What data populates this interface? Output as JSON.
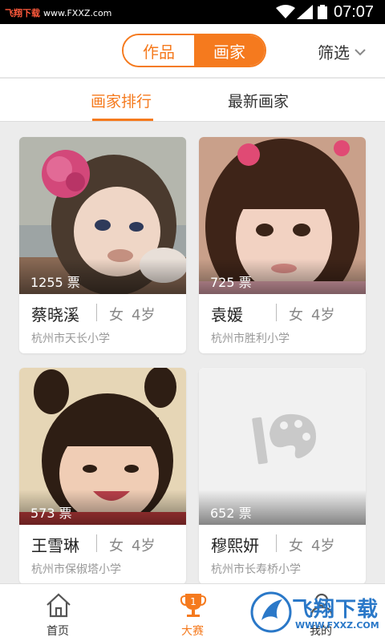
{
  "status_bar": {
    "watermark_site": "飞翔下载",
    "watermark_url": "www.FXXZ.com",
    "time": "07:07"
  },
  "header": {
    "segments": [
      {
        "label": "作品",
        "active": false
      },
      {
        "label": "画家",
        "active": true
      }
    ],
    "filter_label": "筛选"
  },
  "sub_tabs": [
    {
      "label": "画家排行",
      "active": true
    },
    {
      "label": "最新画家",
      "active": false
    }
  ],
  "painters": [
    {
      "votes": "1255 票",
      "name": "蔡晓溪",
      "gender": "女",
      "age": "4岁",
      "school": "杭州市天长小学"
    },
    {
      "votes": "725 票",
      "name": "袁媛",
      "gender": "女",
      "age": "4岁",
      "school": "杭州市胜利小学"
    },
    {
      "votes": "573 票",
      "name": "王雪琳",
      "gender": "女",
      "age": "4岁",
      "school": "杭州市保俶塔小学"
    },
    {
      "votes": "652 票",
      "name": "穆熙妍",
      "gender": "女",
      "age": "4岁",
      "school": "杭州市长寿桥小学"
    }
  ],
  "bottom_nav": [
    {
      "label": "首页",
      "icon": "home-icon",
      "active": false
    },
    {
      "label": "大赛",
      "icon": "trophy-icon",
      "badge": "1",
      "active": true
    },
    {
      "label": "我的",
      "icon": "user-icon",
      "active": false
    }
  ],
  "watermark": {
    "brand": "飞翔下载",
    "url": "WWW.FXXZ.COM"
  },
  "colors": {
    "accent": "#f57a1e",
    "watermark_blue": "#2a78c8"
  }
}
